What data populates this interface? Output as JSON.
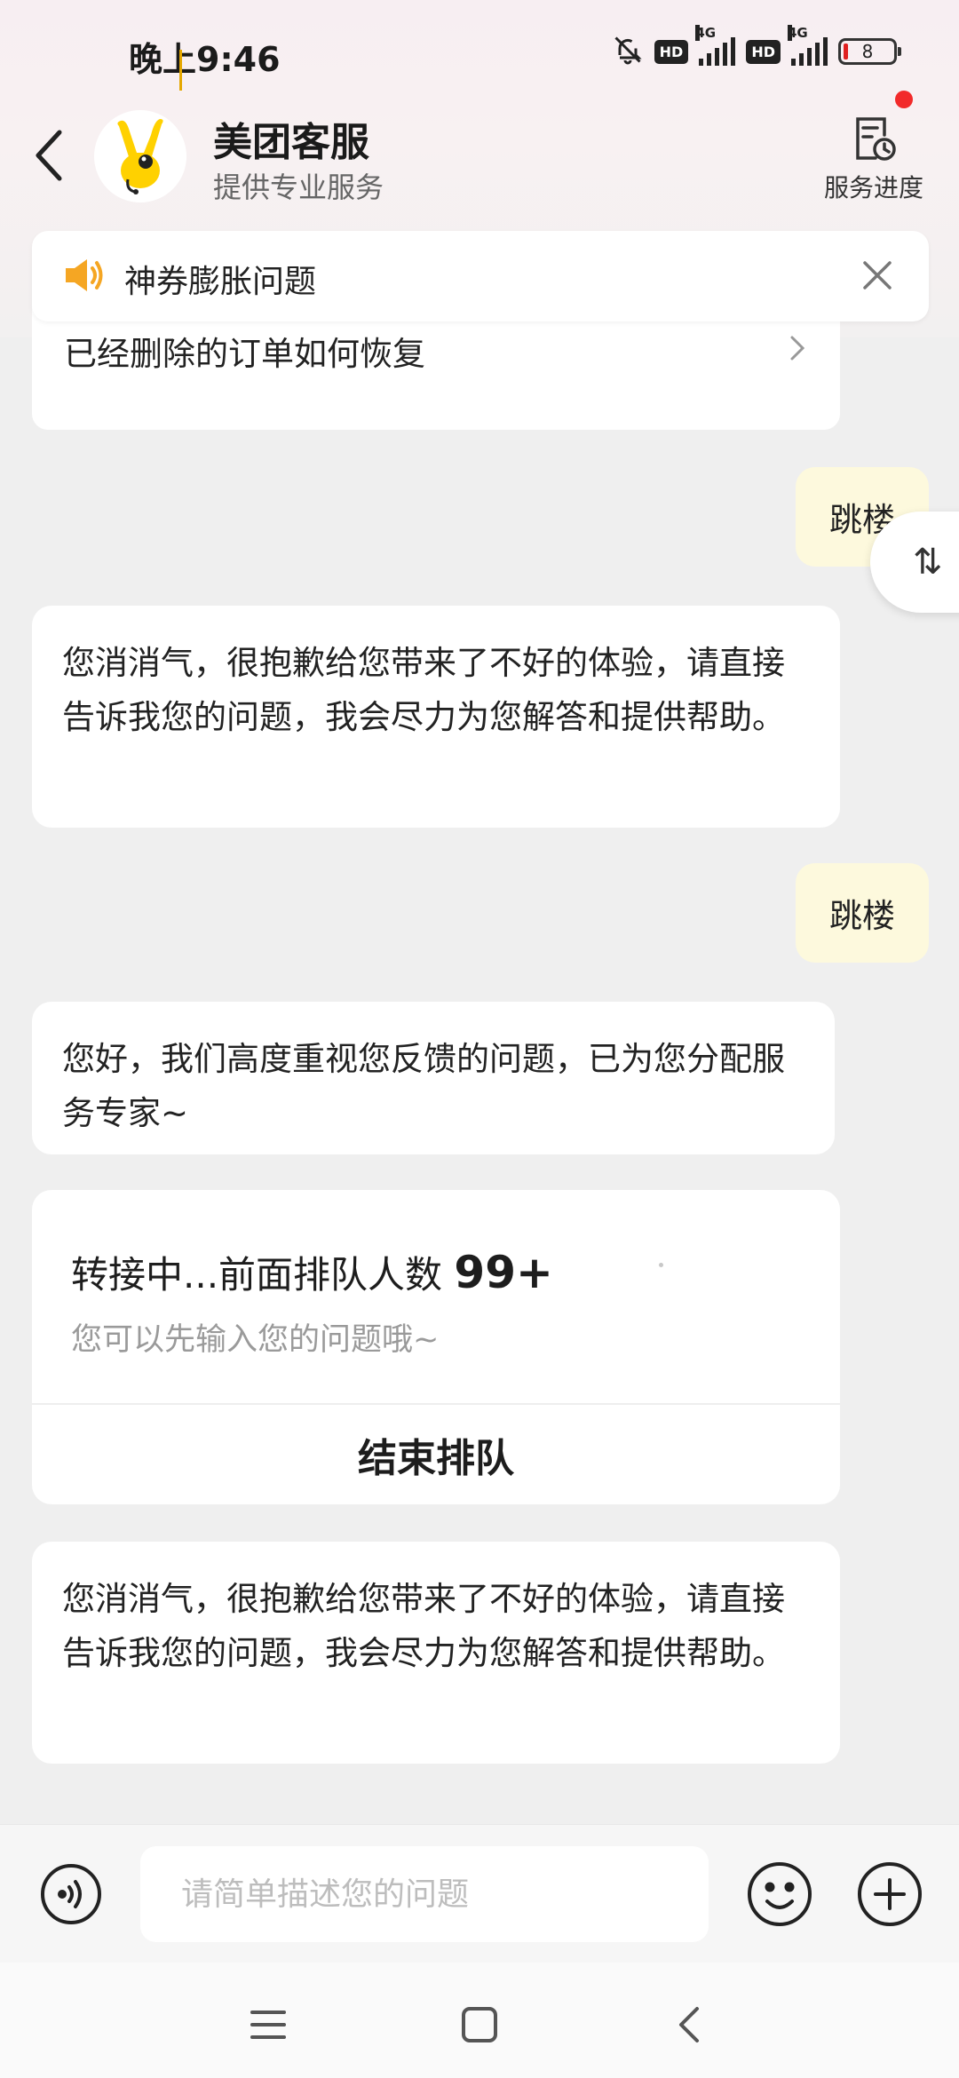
{
  "status_bar": {
    "time": "晚上9:46",
    "hd1": "HD",
    "net1": "4G",
    "hd2": "HD",
    "net2": "4G",
    "battery": "8"
  },
  "header": {
    "title": "美团客服",
    "subtitle": "提供专业服务",
    "progress_label": "服务进度"
  },
  "notice": {
    "text": "神券膨胀问题"
  },
  "partial_card": {
    "text": "已经删除的订单如何恢复"
  },
  "messages": {
    "user1": "跳楼",
    "bot1": "您消消气，很抱歉给您带来了不好的体验，请直接告诉我您的问题，我会尽力为您解答和提供帮助。",
    "user2": "跳楼",
    "bot2": "您好，我们高度重视您反馈的问题，已为您分配服务专家~",
    "bot3": "您消消气，很抱歉给您带来了不好的体验，请直接告诉我您的问题，我会尽力为您解答和提供帮助。"
  },
  "queue": {
    "title": "转接中...前面排队人数 ",
    "count": "99+",
    "hint": "您可以先输入您的问题哦~",
    "end_label": "结束排队"
  },
  "input": {
    "placeholder": "请简单描述您的问题"
  },
  "scroll_fab": {
    "glyph": "⇅"
  },
  "colors": {
    "accent_yellow": "#ffd100",
    "user_bubble": "#fdf9dd",
    "red_dot": "#f22a2a",
    "speaker_orange": "#f5a623"
  }
}
